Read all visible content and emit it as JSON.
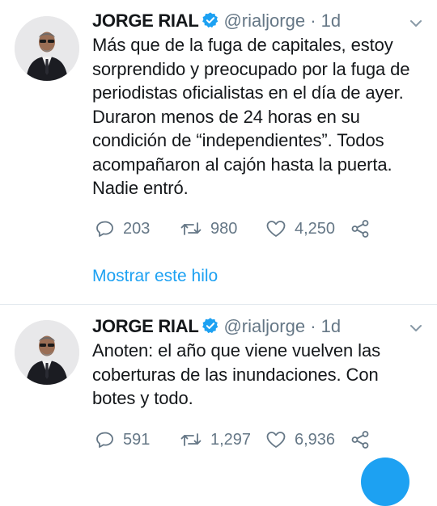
{
  "tweets": [
    {
      "author_name": "JORGE RIAL",
      "handle": "@rialjorge",
      "separator": "·",
      "time": "1d",
      "text_lines": [
        "Más que de la fuga de capitales, estoy",
        "sorprendido y preocupado por la fuga de",
        "periodistas oficialistas en el día de ayer.",
        "Duraron menos de 24 horas en su",
        "condición de “independientes”. Todos",
        "acompañaron al cajón hasta la puerta.",
        "Nadie entró."
      ],
      "replies": "203",
      "retweets": "980",
      "likes": "4,250",
      "show_thread": "Mostrar este hilo"
    },
    {
      "author_name": "JORGE RIAL",
      "handle": "@rialjorge",
      "separator": "·",
      "time": "1d",
      "text_lines": [
        "Anoten: el año que viene vuelven las",
        "coberturas de las inundaciones. Con",
        "botes y todo."
      ],
      "replies": "591",
      "retweets": "1,297",
      "likes": "6,936"
    }
  ],
  "icons": {
    "verified": "verified-badge-icon",
    "caret": "chevron-down-icon",
    "reply": "reply-icon",
    "retweet": "retweet-icon",
    "like": "heart-icon",
    "share": "share-icon"
  },
  "colors": {
    "accent": "#1da1f2",
    "muted": "#657786",
    "text": "#14171a",
    "divider": "#e1e8ed"
  }
}
